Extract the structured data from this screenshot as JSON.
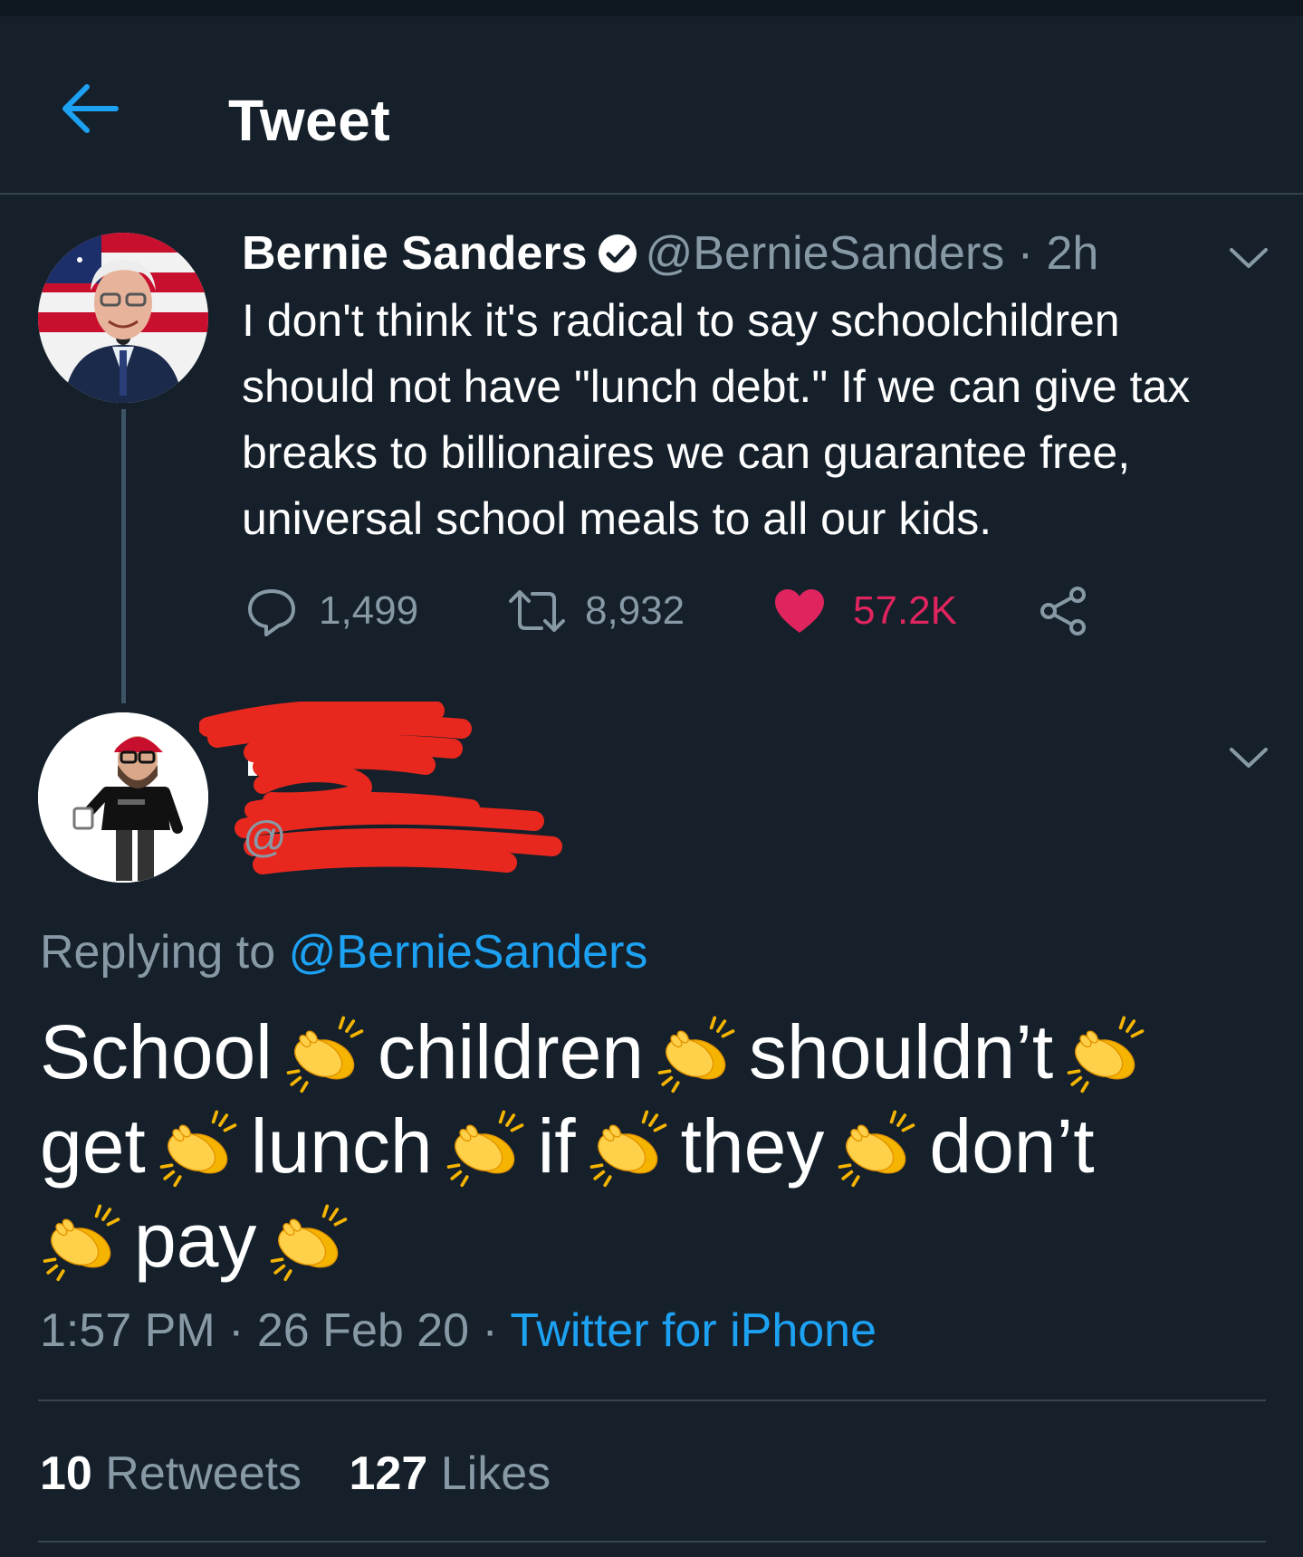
{
  "header": {
    "title": "Tweet"
  },
  "tweet": {
    "name": "Bernie Sanders",
    "handle": "@BernieSanders",
    "separator": "·",
    "age": "2h",
    "text": "I don't think it's radical to say schoolchildren should not have \"lunch debt.\" If we can give tax breaks to billionaires we can guarantee free, universal school meals to all our kids.",
    "replies": "1,499",
    "retweets": "8,932",
    "likes": "57.2K"
  },
  "reply": {
    "handle_visible": "@",
    "replying_label": "Replying to",
    "replying_handle": "@BernieSanders",
    "words": [
      "School",
      "children",
      "shouldn’t",
      "get",
      "lunch",
      "if",
      "they",
      "don’t"
    ],
    "last_word": "pay",
    "time": "1:57 PM",
    "date": "26 Feb 20",
    "separator": "·",
    "source": "Twitter for iPhone",
    "retweet_count": "10",
    "retweet_label": "Retweets",
    "like_count": "127",
    "like_label": "Likes"
  },
  "colors": {
    "background": "#15202b",
    "accent": "#1da1f2",
    "like": "#e0245e",
    "muted": "#8899a6",
    "redaction": "#e8281e"
  },
  "icons": [
    "back-arrow-icon",
    "verified-icon",
    "chevron-down-icon",
    "reply-icon",
    "retweet-icon",
    "heart-icon",
    "share-icon",
    "clapping-hands-icon"
  ]
}
